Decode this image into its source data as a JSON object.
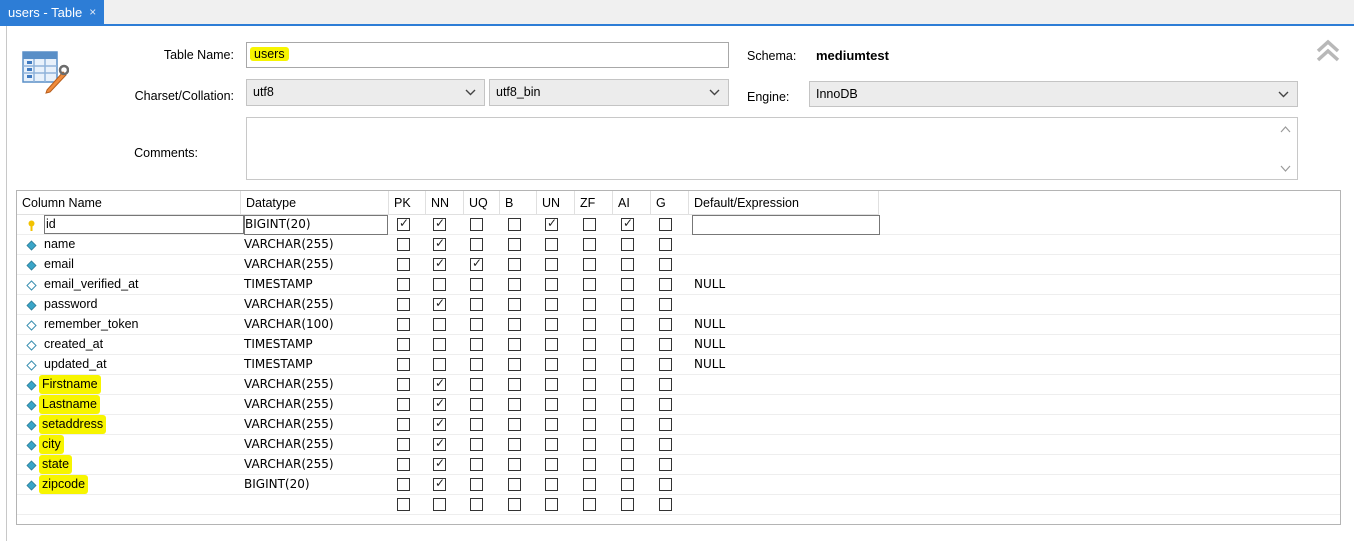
{
  "tab": {
    "title": "users - Table",
    "close": "×"
  },
  "form": {
    "table_name_label": "Table Name:",
    "table_name_value": "users",
    "schema_label": "Schema:",
    "schema_value": "mediumtest",
    "charset_label": "Charset/Collation:",
    "charset_value": "utf8",
    "collation_value": "utf8_bin",
    "engine_label": "Engine:",
    "engine_value": "InnoDB",
    "comments_label": "Comments:",
    "comments_value": ""
  },
  "grid": {
    "headers": [
      "Column Name",
      "Datatype",
      "PK",
      "NN",
      "UQ",
      "B",
      "UN",
      "ZF",
      "AI",
      "G",
      "Default/Expression"
    ],
    "rows": [
      {
        "name": "id",
        "type": "BIGINT(20)",
        "default": "",
        "key": "pk",
        "flags": [
          1,
          1,
          0,
          0,
          1,
          0,
          1,
          0
        ],
        "highlight": false
      },
      {
        "name": "name",
        "type": "VARCHAR(255)",
        "default": "",
        "key": "nn",
        "flags": [
          0,
          1,
          0,
          0,
          0,
          0,
          0,
          0
        ],
        "highlight": false
      },
      {
        "name": "email",
        "type": "VARCHAR(255)",
        "default": "",
        "key": "nn",
        "flags": [
          0,
          1,
          1,
          0,
          0,
          0,
          0,
          0
        ],
        "highlight": false
      },
      {
        "name": "email_verified_at",
        "type": "TIMESTAMP",
        "default": "NULL",
        "key": "null",
        "flags": [
          0,
          0,
          0,
          0,
          0,
          0,
          0,
          0
        ],
        "highlight": false
      },
      {
        "name": "password",
        "type": "VARCHAR(255)",
        "default": "",
        "key": "nn",
        "flags": [
          0,
          1,
          0,
          0,
          0,
          0,
          0,
          0
        ],
        "highlight": false
      },
      {
        "name": "remember_token",
        "type": "VARCHAR(100)",
        "default": "NULL",
        "key": "null",
        "flags": [
          0,
          0,
          0,
          0,
          0,
          0,
          0,
          0
        ],
        "highlight": false
      },
      {
        "name": "created_at",
        "type": "TIMESTAMP",
        "default": "NULL",
        "key": "null",
        "flags": [
          0,
          0,
          0,
          0,
          0,
          0,
          0,
          0
        ],
        "highlight": false
      },
      {
        "name": "updated_at",
        "type": "TIMESTAMP",
        "default": "NULL",
        "key": "null",
        "flags": [
          0,
          0,
          0,
          0,
          0,
          0,
          0,
          0
        ],
        "highlight": false
      },
      {
        "name": "Firstname",
        "type": "VARCHAR(255)",
        "default": "",
        "key": "nn",
        "flags": [
          0,
          1,
          0,
          0,
          0,
          0,
          0,
          0
        ],
        "highlight": true
      },
      {
        "name": "Lastname",
        "type": "VARCHAR(255)",
        "default": "",
        "key": "nn",
        "flags": [
          0,
          1,
          0,
          0,
          0,
          0,
          0,
          0
        ],
        "highlight": true
      },
      {
        "name": "setaddress",
        "type": "VARCHAR(255)",
        "default": "",
        "key": "nn",
        "flags": [
          0,
          1,
          0,
          0,
          0,
          0,
          0,
          0
        ],
        "highlight": true
      },
      {
        "name": "city",
        "type": "VARCHAR(255)",
        "default": "",
        "key": "nn",
        "flags": [
          0,
          1,
          0,
          0,
          0,
          0,
          0,
          0
        ],
        "highlight": true
      },
      {
        "name": "state",
        "type": "VARCHAR(255)",
        "default": "",
        "key": "nn",
        "flags": [
          0,
          1,
          0,
          0,
          0,
          0,
          0,
          0
        ],
        "highlight": true
      },
      {
        "name": "zipcode",
        "type": "BIGINT(20)",
        "default": "",
        "key": "nn",
        "flags": [
          0,
          1,
          0,
          0,
          0,
          0,
          0,
          0
        ],
        "highlight": true
      },
      {
        "name": "",
        "type": "",
        "default": "",
        "key": "none",
        "flags": [
          0,
          0,
          0,
          0,
          0,
          0,
          0,
          0
        ],
        "highlight": false
      }
    ]
  },
  "colors": {
    "accent": "#2d7dd6",
    "highlight": "#f7f500",
    "key_icon": "#f2c200",
    "column_icon": "#3aa5c8"
  },
  "icons": {
    "table": "table-edit-icon",
    "collapse": "double-chevron-up-icon",
    "dropdown": "chevron-down-icon",
    "key": "primary-key-icon",
    "column": "column-diamond-icon"
  }
}
